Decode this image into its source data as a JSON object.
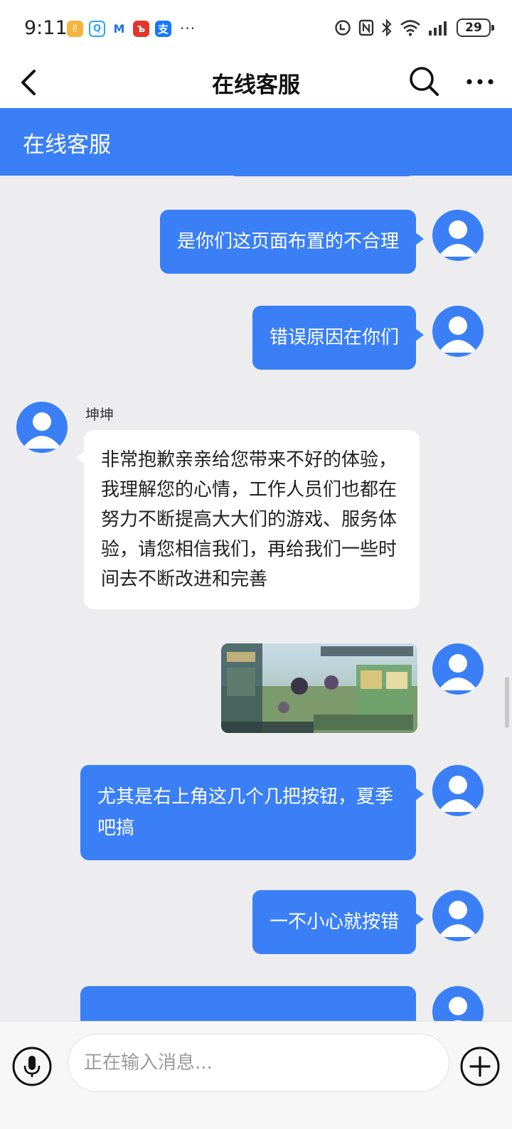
{
  "status_bar": {
    "time": "9:11",
    "more_indicator": "···",
    "battery_level": "29",
    "app_icons": [
      {
        "name": "app-notification-icon-1",
        "glyph": "✌",
        "color": "#f4b43e"
      },
      {
        "name": "app-notification-icon-2",
        "glyph": "Q",
        "color": "#2aa4f4"
      },
      {
        "name": "app-notification-icon-3",
        "glyph": "M",
        "color": "#1f6fe5"
      },
      {
        "name": "app-notification-icon-4",
        "glyph": "ъ",
        "color": "#e0362c"
      },
      {
        "name": "alipay-icon",
        "glyph": "支",
        "color": "#1677ff"
      }
    ]
  },
  "nav": {
    "title": "在线客服",
    "icons": [
      "back-arrow-icon",
      "search-icon",
      "more-icon"
    ]
  },
  "header": {
    "title": "在线客服",
    "color": "#3a7ff5"
  },
  "messages": [
    {
      "from": "me",
      "type": "text",
      "text": "是你们这页面布置的不合理"
    },
    {
      "from": "me",
      "type": "text",
      "text": "错误原因在你们"
    },
    {
      "from": "agent",
      "sender": "坤坤",
      "type": "text",
      "text": "非常抱歉亲亲给您带来不好的体验，我理解您的心情，工作人员们也都在努力不断提高大大们的游戏、服务体验，请您相信我们，再给我们一些时间去不断改进和完善"
    },
    {
      "from": "me",
      "type": "image",
      "description_icon": "game-screenshot-image"
    },
    {
      "from": "me",
      "type": "text",
      "text": "尤其是右上角这几个几把按钮，夏季吧搞"
    },
    {
      "from": "me",
      "type": "text",
      "text": "一不小心就按错"
    }
  ],
  "input": {
    "placeholder": "正在输入消息..."
  },
  "colors": {
    "accent": "#3a7ff5",
    "chat_background": "#ededf0",
    "agent_bubble": "#ffffff"
  }
}
